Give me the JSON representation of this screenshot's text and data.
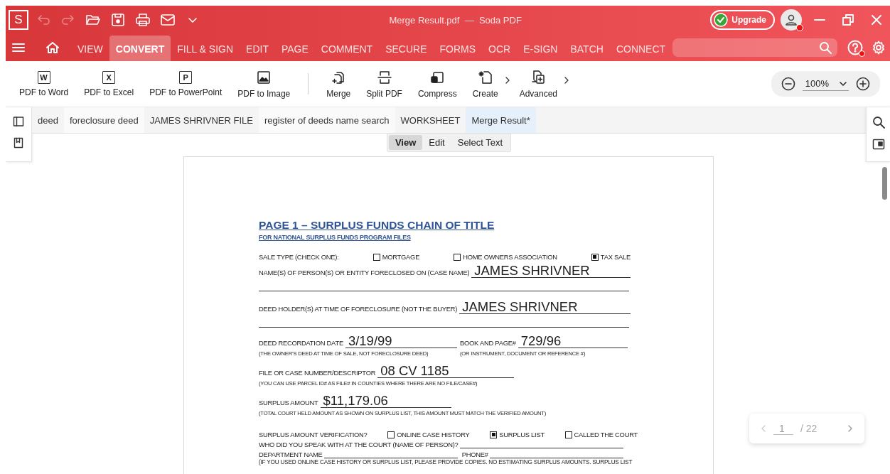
{
  "title_bar": {
    "logo": "S",
    "title": "Merge Result.pdf  —  Soda PDF",
    "upgrade": "Upgrade",
    "quick_access": [
      {
        "kind": "undo",
        "disabled": true
      },
      {
        "kind": "redo",
        "disabled": true
      },
      {
        "kind": "open",
        "disabled": false
      },
      {
        "kind": "save",
        "disabled": false
      },
      {
        "kind": "print",
        "disabled": false
      },
      {
        "kind": "mail",
        "disabled": false
      },
      {
        "kind": "more",
        "disabled": false
      }
    ]
  },
  "menu_tabs": [
    {
      "label": "VIEW",
      "selected": false
    },
    {
      "label": "CONVERT",
      "selected": true
    },
    {
      "label": "FILL & SIGN",
      "selected": false
    },
    {
      "label": "EDIT",
      "selected": false
    },
    {
      "label": "PAGE",
      "selected": false
    },
    {
      "label": "COMMENT",
      "selected": false
    },
    {
      "label": "SECURE",
      "selected": false
    },
    {
      "label": "FORMS",
      "selected": false
    },
    {
      "label": "OCR",
      "selected": false
    },
    {
      "label": "E-SIGN",
      "selected": false
    },
    {
      "label": "BATCH",
      "selected": false
    },
    {
      "label": "CONNECT",
      "selected": false
    }
  ],
  "toolbar": [
    {
      "label": "PDF to Word",
      "kind": "letter",
      "letter": "W"
    },
    {
      "label": "PDF to Excel",
      "kind": "letter",
      "letter": "X"
    },
    {
      "label": "PDF to PowerPoint",
      "kind": "letter",
      "letter": "P"
    },
    {
      "label": "PDF to Image",
      "kind": "image"
    },
    {
      "kind": "separator"
    },
    {
      "label": "Merge",
      "kind": "merge"
    },
    {
      "label": "Split PDF",
      "kind": "split"
    },
    {
      "label": "Compress",
      "kind": "compress"
    },
    {
      "label": "Create",
      "kind": "create",
      "submenu": true
    },
    {
      "label": "Advanced",
      "kind": "advanced",
      "submenu": true
    }
  ],
  "zoom": "100%",
  "doc_tabs": [
    {
      "label": "deed",
      "selected": false
    },
    {
      "label": "foreclosure deed",
      "selected": false
    },
    {
      "label": "JAMES SHRIVNER FILE",
      "selected": false
    },
    {
      "label": "register of deeds name search",
      "selected": false
    },
    {
      "label": "WORKSHEET",
      "selected": false
    },
    {
      "label": "Merge Result*",
      "selected": true
    }
  ],
  "view_modes": [
    {
      "label": "View",
      "selected": true
    },
    {
      "label": "Edit",
      "selected": false
    },
    {
      "label": "Select Text",
      "selected": false
    }
  ],
  "form": {
    "title": "PAGE 1 – SURPLUS FUNDS CHAIN OF TITLE",
    "subtitle": "FOR NATIONAL SURPLUS FUNDS PROGRAM FILES",
    "entries": [
      {
        "kind": "checks",
        "label": "SALE TYPE (CHECK ONE):",
        "options": [
          {
            "label": "MORTGAGE",
            "checked": false
          },
          {
            "label": "HOME OWNERS ASSOCIATION",
            "checked": false
          },
          {
            "label": "TAX SALE",
            "checked": true
          }
        ]
      },
      {
        "kind": "wide",
        "label": "NAME(S) OF PERSON(S) OR ENTITY FORECLOSED ON (CASE NAME)",
        "value": "JAMES SHRIVNER"
      },
      {
        "kind": "wide",
        "label": "DEED HOLDER(S) AT TIME OF FORECLOSURE (NOT THE BUYER)",
        "value": "JAMES SHRIVNER"
      },
      {
        "kind": "pair",
        "fields": [
          {
            "label": "DEED RECORDATION DATE",
            "value": "3/19/99",
            "note": "(THE OWNER’S DEED AT TIME OF SALE, NOT FORECLOSURE DEED)"
          },
          {
            "label": "BOOK AND PAGE#",
            "value": "729/96",
            "note": "(OR INSTRUMENT, DOCUMENT OR REFERENCE #)"
          }
        ]
      },
      {
        "kind": "single",
        "label": "FILE OR CASE NUMBER/DESCRIPTOR",
        "value": "08 CV 1185",
        "note": "(YOU CAN USE PARCEL ID# AS FILE# IN COUNTIES WHERE THERE ARE NO FILE/CASE#)"
      },
      {
        "kind": "single",
        "label": "SURPLUS AMOUNT",
        "value": "$11,179.06",
        "note": "(TOTAL COURT HELD AMOUNT AS SHOWN ON SURPLUS LIST, THIS AMOUNT MUST MATCH THE VERIFIED AMOUNT)"
      },
      {
        "kind": "checks",
        "label": "SURPLUS AMOUNT VERIFICATION?",
        "options": [
          {
            "label": "ONLINE CASE HISTORY",
            "checked": false
          },
          {
            "label": "SURPLUS LIST",
            "checked": true
          },
          {
            "label": "CALLED THE COURT",
            "checked": false
          }
        ]
      },
      {
        "kind": "blanks",
        "fields": [
          {
            "label": "WHO DID YOU SPEAK WITH AT THE COURT (NAME OF PERSON)?"
          }
        ]
      },
      {
        "kind": "blanks",
        "fields": [
          {
            "label": "DEPARTMENT NAME"
          },
          {
            "label": "PHONE#"
          }
        ]
      },
      {
        "kind": "note",
        "text": "(IF YOU USED ONLINE CASE HISTORY OR SURPLUS LIST, PLEASE PROVIDE COPIES. NO ESTIMATING SURPLUS AMOUNTS. SURPLUS LIST"
      }
    ]
  },
  "page_nav": {
    "current": "1",
    "total": "/ 22"
  }
}
